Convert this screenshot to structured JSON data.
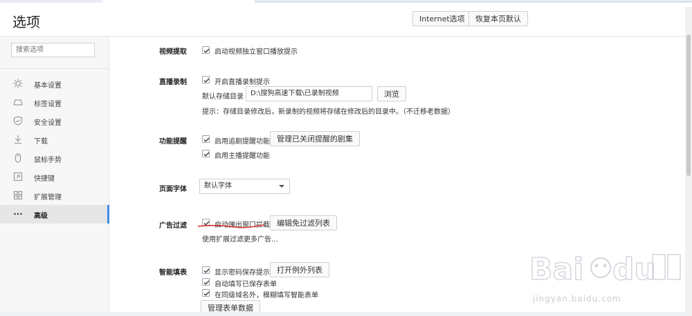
{
  "header": {
    "title": "选项",
    "internet_options": "Internet选项",
    "restore_defaults": "恢复本页默认"
  },
  "sidebar": {
    "search_placeholder": "搜索选项",
    "items": [
      {
        "label": "基本设置",
        "icon": "gear-icon"
      },
      {
        "label": "标签设置",
        "icon": "tab-icon"
      },
      {
        "label": "安全设置",
        "icon": "shield-icon"
      },
      {
        "label": "下载",
        "icon": "download-icon"
      },
      {
        "label": "鼠标手势",
        "icon": "mouse-icon"
      },
      {
        "label": "快捷键",
        "icon": "shortcut-icon"
      },
      {
        "label": "扩展管理",
        "icon": "extensions-icon"
      },
      {
        "label": "高级",
        "icon": "more-icon",
        "active": true
      }
    ]
  },
  "content": {
    "video": {
      "label": "视频提取",
      "option": "启动视频独立窗口播放提示",
      "checked": true
    },
    "live": {
      "label": "直播录制",
      "option": "开启直播录制提示",
      "checked": true,
      "dir_label": "默认存储目录",
      "dir_value": "D:\\搜狗高速下载\\已录制视频",
      "browse": "浏览",
      "hint": "提示：存储目录修改后，新录制的视频将存储在修改后的目录中。（不迁移老数据）"
    },
    "feature": {
      "label": "功能提醒",
      "option1": "启用追剧提醒功能",
      "manage_button": "管理已关闭提醒的剧集",
      "option2": "启用主播提醒功能"
    },
    "font": {
      "label": "页面字体",
      "value": "默认字体"
    },
    "ad": {
      "label": "广告过滤",
      "option": "启动弹出窗口拦截",
      "edit_button": "编辑免过滤列表",
      "more": "使用扩展过滤更多广告..."
    },
    "autofill": {
      "label": "智能填表",
      "option1": "显示密码保存提示",
      "exceptions_button": "打开例外列表",
      "option2": "自动填写已保存表单",
      "option3": "在同级域名外，模糊填写智能表单",
      "manage_button": "管理表单数据"
    }
  },
  "watermark": {
    "text": "jingyan.baidu.com"
  },
  "colors": {
    "accent": "#3d8ee8",
    "annotation": "#d9302c"
  }
}
